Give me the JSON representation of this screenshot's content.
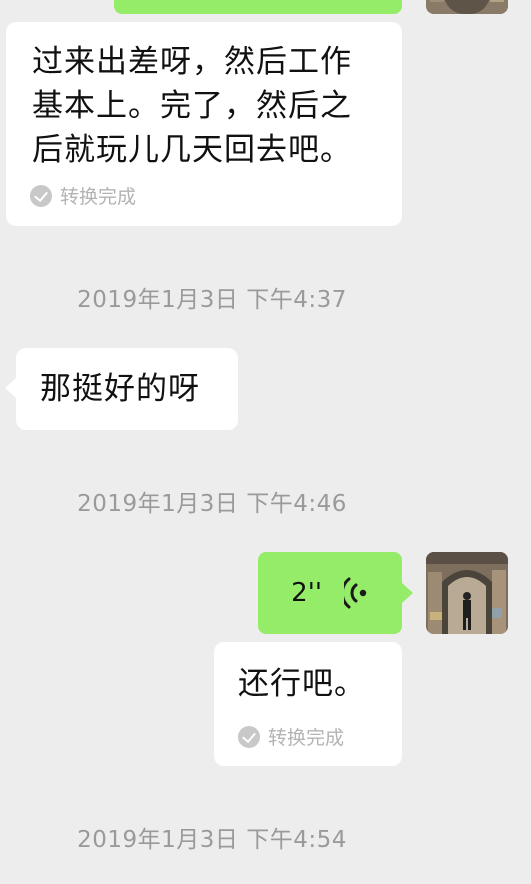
{
  "messages": {
    "m1_text": "过来出差呀，然后工作基本上。完了，然后之后就玩儿几天回去吧。",
    "m1_line1": "过来出差呀，然后工作",
    "m1_line2": "基本上。完了，然后之",
    "m1_line3": "后就玩儿几天回去吧。",
    "m1_status": "转换完成",
    "ts1": "2019年1月3日 下午4:37",
    "m2_text": "那挺好的呀",
    "ts2": "2019年1月3日 下午4:46",
    "voice_duration": "2''",
    "m3_text": "还行吧。",
    "m3_status": "转换完成",
    "ts3": "2019年1月3日 下午4:54"
  },
  "colors": {
    "background": "#ededed",
    "sent_bubble": "#95ec69",
    "received_bubble": "#ffffff",
    "timestamp_text": "#9a9a9a"
  },
  "icons": {
    "converted": "check-circle-icon",
    "voice": "voice-wave-icon"
  }
}
